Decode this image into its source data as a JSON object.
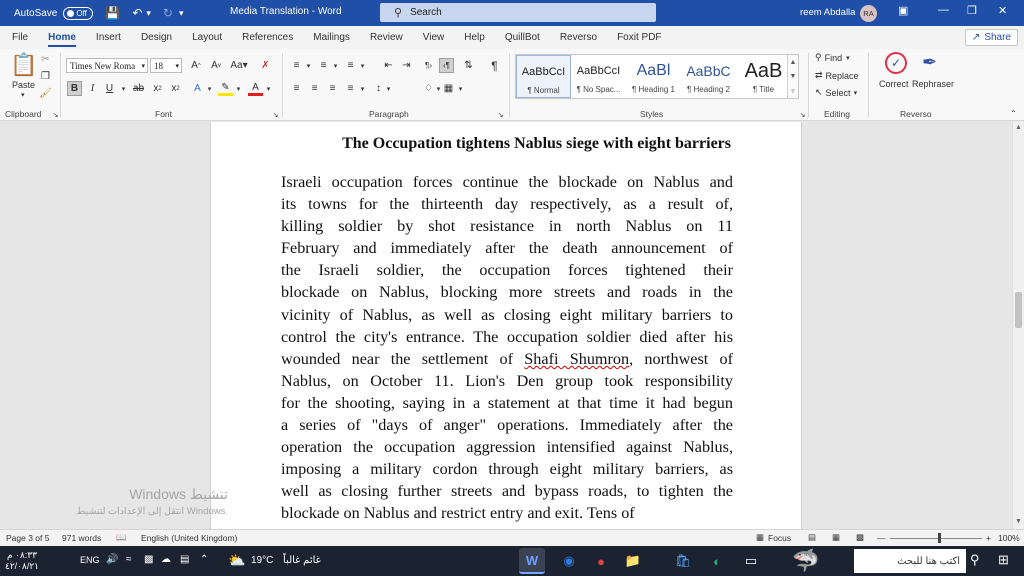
{
  "titlebar": {
    "autosave_label": "AutoSave",
    "autosave_state": "Off",
    "title": "Media Translation  -  Word",
    "search_placeholder": "Search",
    "user_name": "reem Abdalla",
    "user_initials": "RA"
  },
  "tabs": [
    "File",
    "Home",
    "Insert",
    "Design",
    "Layout",
    "References",
    "Mailings",
    "Review",
    "View",
    "Help",
    "QuillBot",
    "Reverso",
    "Foxit PDF"
  ],
  "share_label": "Share",
  "ribbon": {
    "clipboard": {
      "paste_label": "Paste",
      "group": "Clipboard"
    },
    "font": {
      "font_name": "Times New Roma",
      "font_size": "18",
      "grow": "A^",
      "case": "Aa",
      "group": "Font"
    },
    "paragraph": {
      "group": "Paragraph"
    },
    "styles": {
      "group": "Styles",
      "items": [
        {
          "sample": "AaBbCcI",
          "name": "¶ Normal"
        },
        {
          "sample": "AaBbCcI",
          "name": "¶ No Spac..."
        },
        {
          "sample": "AaBl",
          "name": "¶ Heading 1"
        },
        {
          "sample": "AaBbC",
          "name": "¶ Heading 2"
        },
        {
          "sample": "AaB",
          "name": "¶ Title"
        }
      ]
    },
    "editing": {
      "find": "Find",
      "replace": "Replace",
      "select": "Select",
      "group": "Editing"
    },
    "reverso": {
      "correct": "Correct",
      "rephraser": "Rephraser",
      "group": "Reverso"
    }
  },
  "document": {
    "heading": "The Occupation tightens Nablus siege with eight barriers",
    "lines": [
      "Israeli occupation forces continue the blockade on Nablus and",
      "its towns for the thirteenth day respectively, as a result of,",
      "killing soldier by shot resistance in north Nablus on 11",
      "February   and immediately after the death announcement of",
      "the Israeli soldier, the occupation forces tightened their",
      "blockade on Nablus, blocking more streets and roads in the",
      "vicinity of Nablus, as well as closing eight military barriers to",
      "control the city's entrance. The occupation soldier died after his",
      "wounded near the settlement of Shafi  Shumron, northwest of",
      "Nablus, on October 11.  Lion's Den group took responsibility",
      "for the shooting, saying in a statement at that time it had begun",
      "a series of \"days of anger\" operations. Immediately after the",
      "operation the occupation aggression intensified against Nablus,",
      "imposing a military cordon through eight military barriers, as",
      "well as closing further streets and bypass roads, to tighten the",
      "blockade on Nablus and restrict entry and exit.   Tens of"
    ]
  },
  "watermark": {
    "title": "Windows تنشيط",
    "sub": "انتقل إلى الإعدادات لتنشيط Windows."
  },
  "statusbar": {
    "page": "Page 3 of 5",
    "words": "971 words",
    "language": "English (United Kingdom)",
    "focus": "Focus",
    "zoom": "100%"
  },
  "taskbar": {
    "time": "٠٨:٣٣ م",
    "date": "٤٢/٠٨/٢١",
    "lang": "ENG",
    "weather_temp": "19°C",
    "weather_text": "غائم غالباً",
    "search_text": "اكتب هنا للبحث"
  },
  "colors": {
    "word_blue": "#1f4fa6",
    "taskbar": "#1c2330"
  }
}
